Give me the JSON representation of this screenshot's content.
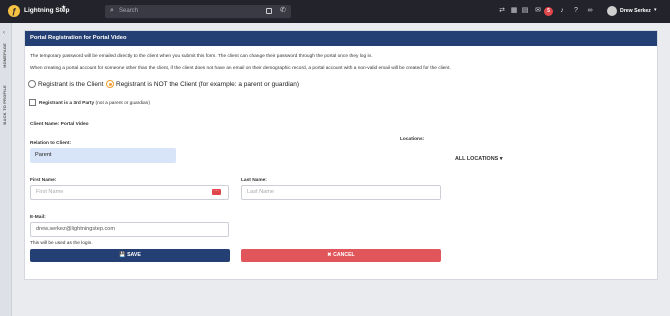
{
  "topbar": {
    "brand": "Lightning Step",
    "logo_letter": "ƒ",
    "search_placeholder": "Search",
    "user_name": "Drew Serkez",
    "notification_count": "5",
    "icons": [
      "transfer-icon",
      "calendar-icon",
      "grid-icon",
      "chat-icon",
      "bell-icon",
      "help-icon",
      "link-icon"
    ]
  },
  "side": {
    "items": [
      "HOMEPAGE",
      "BACK TO PROFILE"
    ]
  },
  "form": {
    "title": "Portal Registration for Portal Video",
    "intro_1": "The temporary password will be emailed directly to the client when you submit this form. The client can change their password through the portal once they log in.",
    "intro_2": "When creating a portal account for someone other than the client, if the client does not have an email on their demographic record, a portal account with a non-valid email will be created for the client.",
    "radio_client": "Registrant is the Client",
    "radio_not_client": "Registrant is NOT the Client",
    "radio_not_client_hint": "(for example: a parent or guardian)",
    "selected_radio": "not_client",
    "third_party_label": "Registrant is a 3rd Party",
    "third_party_hint": "(not a parent or guardian)",
    "client_name_label": "Client Name: Portal Video",
    "relation_label": "Relation to Client:",
    "relation_value": "Parent",
    "locations_label": "Locations:",
    "locations_value": "ALL LOCATIONS ▾",
    "first_name_label": "First Name:",
    "first_name_placeholder": "First Name",
    "last_name_label": "Last Name:",
    "last_name_placeholder": "Last Name",
    "email_label": "E-Mail:",
    "email_value": "drew.serkez@lightningstep.com",
    "email_hint": "This will be used as the login.",
    "save_label": "💾 SAVE",
    "cancel_label": "✖ CANCEL"
  }
}
